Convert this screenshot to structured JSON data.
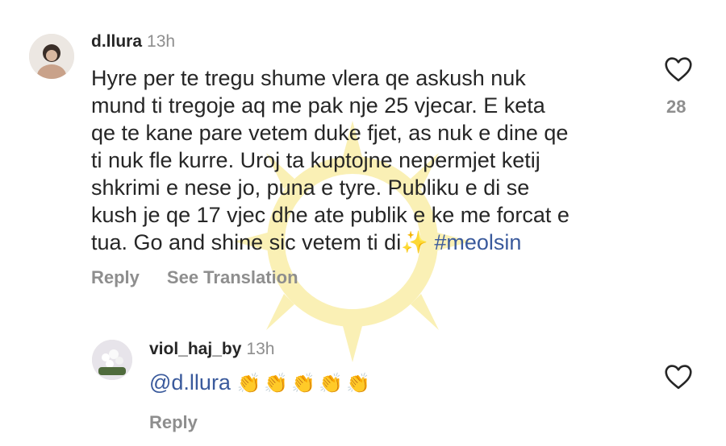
{
  "comment1": {
    "username": "d.llura",
    "time": "13h",
    "lines": [
      "Hyre per te tregu shume vlera qe askush nuk",
      "mund ti tregoje aq me pak nje 25 vjecar. E keta",
      "qe te kane pare vetem duke fjet, as nuk e dine qe",
      "ti nuk fle kurre. Uroj ta kuptojne nepermjet ketij",
      "shkrimi e nese jo, puna e tyre. Publiku e di se",
      "kush je qe 17 vjec dhe ate publik e ke me forcat e"
    ],
    "last_line_text": "tua. Go and shine sic vetem ti di",
    "sparkle": "✨",
    "hashtag": "#meolsin",
    "reply_label": "Reply",
    "translate_label": "See Translation",
    "likes": "28"
  },
  "comment2": {
    "username": "viol_haj_by",
    "time": "13h",
    "mention": "@d.llura",
    "emojis": "👏👏👏👏👏",
    "reply_label": "Reply"
  },
  "colors": {
    "link": "#3a5a9c",
    "muted": "#8e8e8e",
    "text": "#262626",
    "watermark": "#f6e47a"
  }
}
